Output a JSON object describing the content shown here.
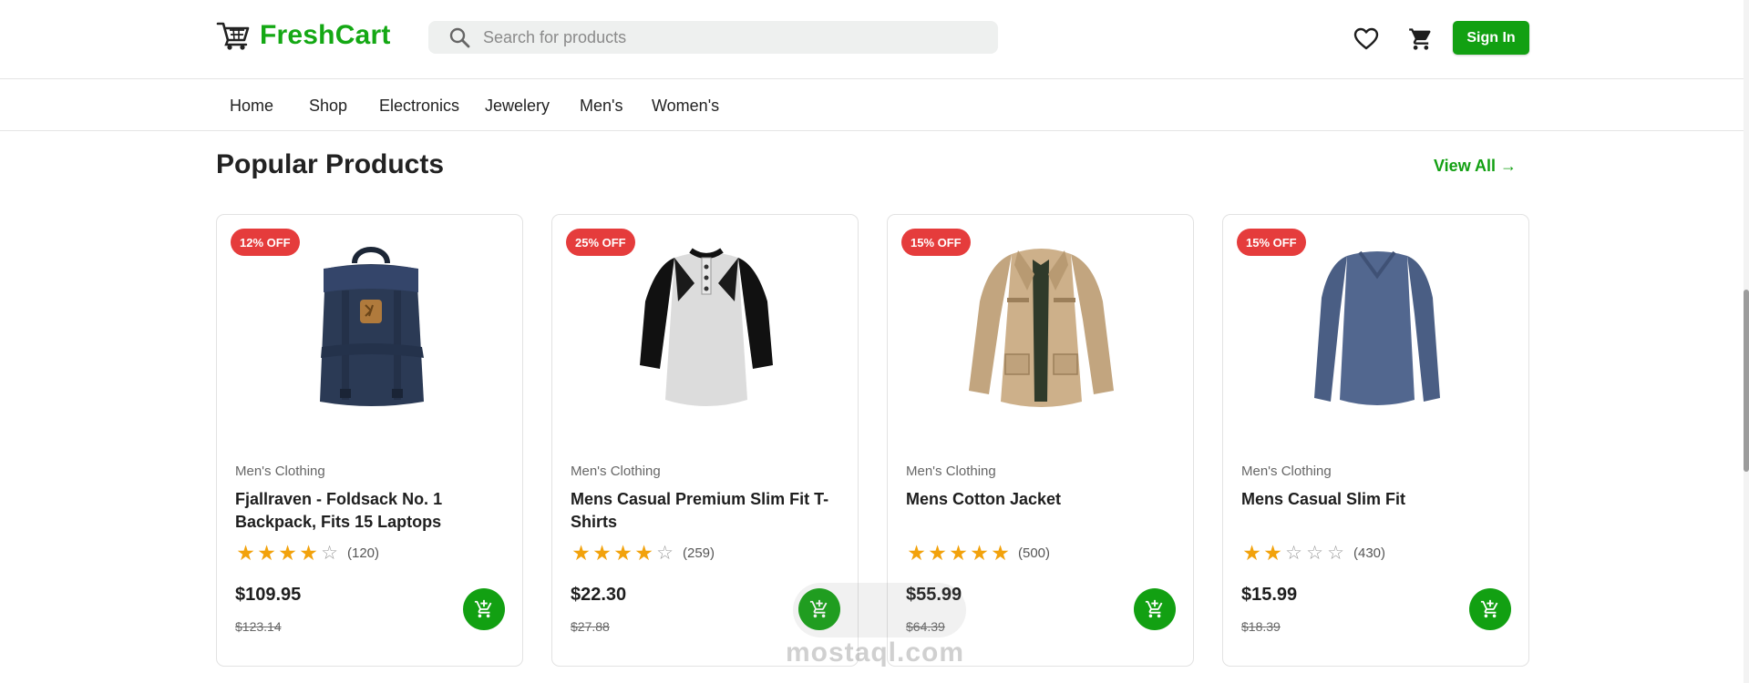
{
  "brand": {
    "name": "FreshCart",
    "color": "#14a814"
  },
  "search": {
    "placeholder": "Search for products"
  },
  "header": {
    "signin_label": "Sign In",
    "icons": [
      "heart-icon",
      "cart-icon"
    ]
  },
  "nav": [
    "Home",
    "Shop",
    "Electronics",
    "Jewelery",
    "Men's",
    "Women's"
  ],
  "section": {
    "title": "Popular Products",
    "view_all": "View All →"
  },
  "products": [
    {
      "badge": "12% OFF",
      "category": "Men's Clothing",
      "name": "Fjallraven - Foldsack No. 1 Backpack, Fits 15 Laptops",
      "rating": 4,
      "reviews": "(120)",
      "price": "$109.95",
      "old_price": "$123.14",
      "image": "backpack"
    },
    {
      "badge": "25% OFF",
      "category": "Men's Clothing",
      "name": "Mens Casual Premium Slim Fit T-Shirts",
      "rating": 4,
      "reviews": "(259)",
      "price": "$22.30",
      "old_price": "$27.88",
      "image": "raglan-tshirt"
    },
    {
      "badge": "15% OFF",
      "category": "Men's Clothing",
      "name": "Mens Cotton Jacket",
      "rating": 5,
      "reviews": "(500)",
      "price": "$55.99",
      "old_price": "$64.39",
      "image": "jacket"
    },
    {
      "badge": "15% OFF",
      "category": "Men's Clothing",
      "name": "Mens Casual Slim Fit",
      "rating": 2,
      "reviews": "(430)",
      "price": "$15.99",
      "old_price": "$18.39",
      "image": "long-sleeve-shirt"
    }
  ],
  "watermark": "mostaql.com",
  "colors": {
    "accent": "#12a012",
    "badge": "#e53c3c",
    "star": "#f2a20c"
  }
}
